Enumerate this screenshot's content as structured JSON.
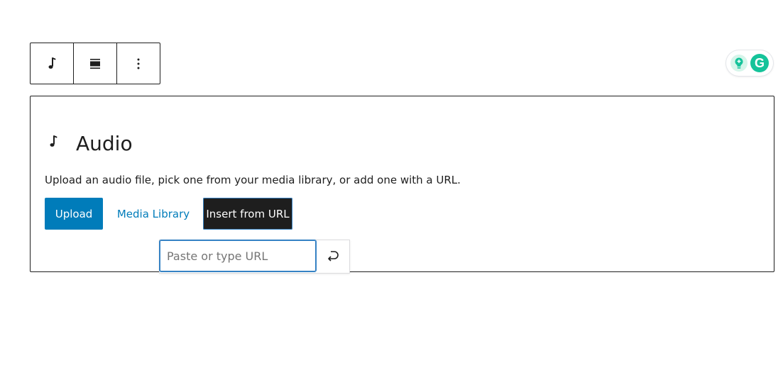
{
  "toolbar": {
    "items": [
      {
        "icon": "audio-icon"
      },
      {
        "icon": "align-icon"
      },
      {
        "icon": "more-options-icon"
      }
    ]
  },
  "grammarly": {
    "logo_letter": "G",
    "colors": {
      "brand": "#15c39a",
      "bulb_bg": "#d6f5ea"
    }
  },
  "block": {
    "title": "Audio",
    "icon": "audio-icon",
    "instructions": "Upload an audio file, pick one from your media library, or add one with a URL.",
    "upload_label": "Upload",
    "media_library_label": "Media Library",
    "insert_url_label": "Insert from URL"
  },
  "url_popover": {
    "placeholder": "Paste or type URL",
    "value": "",
    "submit_icon": "enter-return-icon"
  },
  "colors": {
    "accent": "#007cba",
    "dark": "#1e1e1e",
    "focus": "#3582c4"
  }
}
